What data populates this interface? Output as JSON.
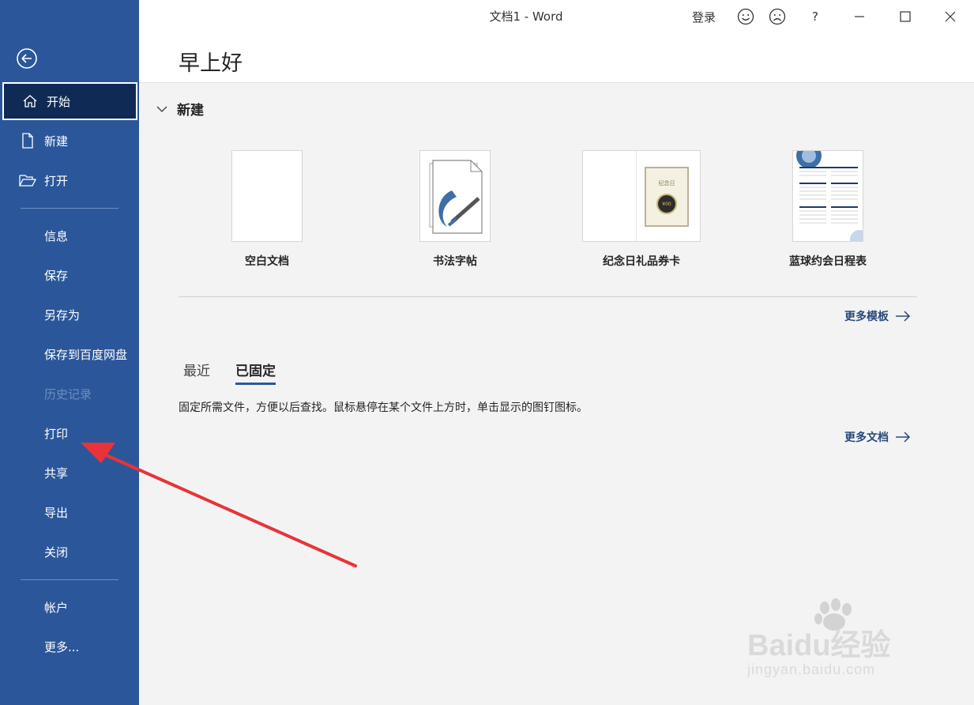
{
  "window": {
    "title": "文档1  -  Word",
    "sign_in": "登录",
    "help": "?"
  },
  "sidebar": {
    "back_icon": "back-arrow-circle-icon",
    "items": [
      {
        "label": "开始",
        "icon": "home-icon"
      },
      {
        "label": "新建",
        "icon": "new-document-icon"
      },
      {
        "label": "打开",
        "icon": "open-folder-icon"
      },
      {
        "label": "信息"
      },
      {
        "label": "保存"
      },
      {
        "label": "另存为"
      },
      {
        "label": "保存到百度网盘"
      },
      {
        "label": "历史记录"
      },
      {
        "label": "打印"
      },
      {
        "label": "共享"
      },
      {
        "label": "导出"
      },
      {
        "label": "关闭"
      },
      {
        "label": "帐户"
      },
      {
        "label": "更多..."
      }
    ]
  },
  "greeting": "早上好",
  "new_section": {
    "heading": "新建",
    "templates": [
      {
        "name": "空白文档"
      },
      {
        "name": "书法字帖"
      },
      {
        "name": "纪念日礼品券卡",
        "thumb_title": "纪念日",
        "thumb_price": "¥00"
      },
      {
        "name": "蓝球约会日程表"
      }
    ],
    "more_templates": "更多模板"
  },
  "recent_section": {
    "tabs": [
      "最近",
      "已固定"
    ],
    "active_tab": "已固定",
    "hint": "固定所需文件，方便以后查找。鼠标悬停在某个文件上方时，单击显示的图钉图标。",
    "more_documents": "更多文档"
  },
  "watermark": {
    "brand": "Baidu经验",
    "url": "jingyan.baidu.com"
  },
  "colors": {
    "sidebar": "#2b579a",
    "active_item": "#0f2b55",
    "annotation_arrow": "#e8333a"
  }
}
